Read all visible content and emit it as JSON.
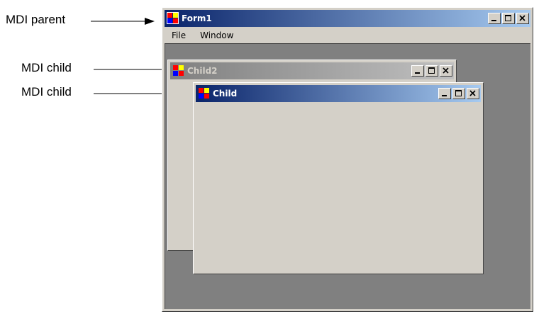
{
  "callouts": {
    "parent": "MDI parent",
    "child_a": "MDI child",
    "child_b": "MDI child"
  },
  "parent_window": {
    "title": "Form1",
    "menu": [
      "File",
      "Window"
    ],
    "active": true
  },
  "child_back": {
    "title": "Child2",
    "active": false
  },
  "child_front": {
    "title": "Child",
    "active": true
  },
  "colors": {
    "active_title_start": "#0a246a",
    "active_title_end": "#a6caf0",
    "inactive_title_start": "#808080",
    "inactive_title_end": "#c0c0c0",
    "face": "#d4d0c8",
    "mdi_background": "#808080"
  },
  "icons": {
    "window_icon": "app-window-icon",
    "minimize": "minimize-icon",
    "maximize": "maximize-icon",
    "close": "close-icon"
  }
}
